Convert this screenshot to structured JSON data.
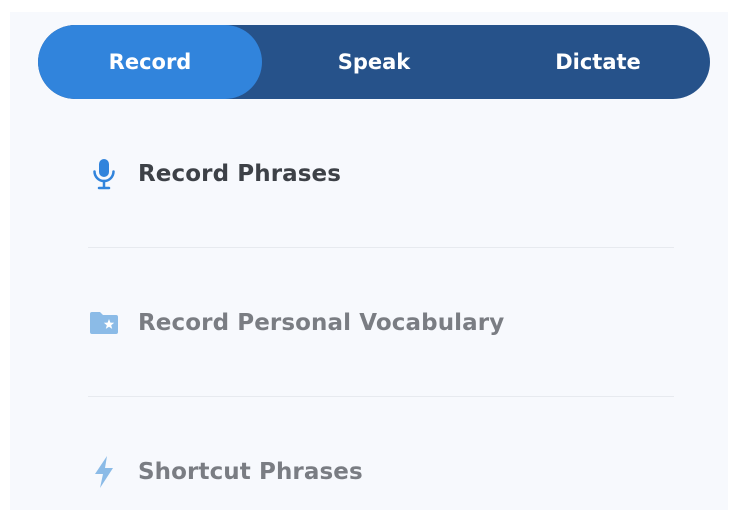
{
  "tabs": {
    "record_label": "Record",
    "speak_label": "Speak",
    "dictate_label": "Dictate",
    "active": "Record"
  },
  "menu": {
    "items": [
      {
        "label": "Record Phrases",
        "icon": "microphone-icon"
      },
      {
        "label": "Record Personal Vocabulary",
        "icon": "folder-star-icon"
      },
      {
        "label": "Shortcut Phrases",
        "icon": "lightning-icon"
      }
    ]
  },
  "colors": {
    "accent": "#3184dc",
    "tab_bar": "#26528a",
    "icon_blue": "#3184dc",
    "icon_light_blue": "#8bbbe7"
  }
}
